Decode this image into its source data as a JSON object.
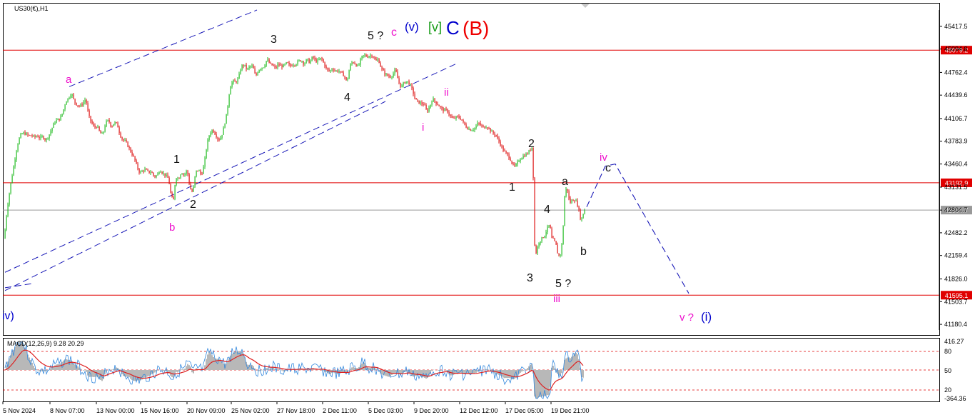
{
  "chart_data": {
    "type": "candlestick",
    "symbol": "US30(€),H1",
    "ylim": [
      41100,
      45650
    ],
    "price_ticks": [
      "45417.5",
      "45094.8",
      "44762.4",
      "44439.6",
      "44106.7",
      "43783.9",
      "43460.4",
      "43131.5",
      "42804.7",
      "42482.2",
      "42159.4",
      "41826.0",
      "41503.7",
      "41180.4"
    ],
    "time_ticks": [
      "5 Nov 2024",
      "8 Nov 07:00",
      "13 Nov 00:00",
      "15 Nov 16:00",
      "20 Nov 09:00",
      "25 Nov 02:00",
      "27 Nov 18:00",
      "2 Dec 11:00",
      "5 Dec 03:00",
      "9 Dec 20:00",
      "12 Dec 12:00",
      "17 Dec 05:00",
      "19 Dec 21:00"
    ],
    "levels": [
      {
        "price": 45079.2,
        "label": "45079.2",
        "color": "#e00000"
      },
      {
        "price": 43192.9,
        "label": "43192.9",
        "color": "#e00000"
      },
      {
        "price": 42804.7,
        "label": "42804.7",
        "color": "#999999"
      },
      {
        "price": 41595.1,
        "label": "41595.1",
        "color": "#e00000"
      }
    ],
    "price_path": [
      [
        0,
        41880
      ],
      [
        4,
        42150
      ],
      [
        8,
        42650
      ],
      [
        12,
        42980
      ],
      [
        16,
        43250
      ],
      [
        20,
        43480
      ],
      [
        24,
        43720
      ],
      [
        28,
        43860
      ],
      [
        32,
        43900
      ],
      [
        36,
        43890
      ],
      [
        40,
        43860
      ],
      [
        44,
        43870
      ],
      [
        48,
        43840
      ],
      [
        52,
        43860
      ],
      [
        56,
        43830
      ],
      [
        60,
        43850
      ],
      [
        64,
        43800
      ],
      [
        68,
        43860
      ],
      [
        72,
        43950
      ],
      [
        76,
        44050
      ],
      [
        80,
        44090
      ],
      [
        84,
        44100
      ],
      [
        88,
        44200
      ],
      [
        92,
        44350
      ],
      [
        96,
        44400
      ],
      [
        100,
        44470
      ],
      [
        104,
        44350
      ],
      [
        108,
        44300
      ],
      [
        112,
        44280
      ],
      [
        116,
        44320
      ],
      [
        120,
        44390
      ],
      [
        124,
        44150
      ],
      [
        128,
        44050
      ],
      [
        132,
        43980
      ],
      [
        136,
        44000
      ],
      [
        140,
        43900
      ],
      [
        144,
        43880
      ],
      [
        148,
        44050
      ],
      [
        152,
        44080
      ],
      [
        156,
        43990
      ],
      [
        160,
        44050
      ],
      [
        164,
        44030
      ],
      [
        168,
        43880
      ],
      [
        172,
        43800
      ],
      [
        176,
        43780
      ],
      [
        180,
        43700
      ],
      [
        184,
        43620
      ],
      [
        188,
        43540
      ],
      [
        192,
        43420
      ],
      [
        196,
        43330
      ],
      [
        200,
        43370
      ],
      [
        204,
        43380
      ],
      [
        208,
        43340
      ],
      [
        212,
        43350
      ],
      [
        216,
        43280
      ],
      [
        220,
        43300
      ],
      [
        224,
        43380
      ],
      [
        228,
        43330
      ],
      [
        232,
        43300
      ],
      [
        236,
        43250
      ],
      [
        240,
        42980
      ],
      [
        243,
        42950
      ],
      [
        246,
        43280
      ],
      [
        250,
        43250
      ],
      [
        254,
        43350
      ],
      [
        258,
        43300
      ],
      [
        262,
        43380
      ],
      [
        266,
        43120
      ],
      [
        270,
        43050
      ],
      [
        274,
        43350
      ],
      [
        278,
        43380
      ],
      [
        282,
        43300
      ],
      [
        286,
        43450
      ],
      [
        290,
        43750
      ],
      [
        294,
        43900
      ],
      [
        298,
        43950
      ],
      [
        302,
        43880
      ],
      [
        306,
        43800
      ],
      [
        310,
        43850
      ],
      [
        314,
        44000
      ],
      [
        318,
        44200
      ],
      [
        322,
        44550
      ],
      [
        326,
        44640
      ],
      [
        330,
        44620
      ],
      [
        334,
        44680
      ],
      [
        338,
        44850
      ],
      [
        342,
        44870
      ],
      [
        346,
        44800
      ],
      [
        350,
        44850
      ],
      [
        354,
        44850
      ],
      [
        358,
        44700
      ],
      [
        362,
        44800
      ],
      [
        366,
        44830
      ],
      [
        370,
        44850
      ],
      [
        374,
        44950
      ],
      [
        378,
        44880
      ],
      [
        382,
        44860
      ],
      [
        386,
        44820
      ],
      [
        390,
        44880
      ],
      [
        394,
        44850
      ],
      [
        398,
        44860
      ],
      [
        402,
        44900
      ],
      [
        406,
        44850
      ],
      [
        410,
        44880
      ],
      [
        414,
        44880
      ],
      [
        418,
        44920
      ],
      [
        422,
        44940
      ],
      [
        426,
        44880
      ],
      [
        430,
        44950
      ],
      [
        434,
        44900
      ],
      [
        438,
        44990
      ],
      [
        442,
        44920
      ],
      [
        446,
        44930
      ],
      [
        450,
        44970
      ],
      [
        454,
        44880
      ],
      [
        458,
        44800
      ],
      [
        462,
        44780
      ],
      [
        466,
        44820
      ],
      [
        470,
        44780
      ],
      [
        474,
        44790
      ],
      [
        478,
        44750
      ],
      [
        482,
        44720
      ],
      [
        486,
        44620
      ],
      [
        490,
        44850
      ],
      [
        494,
        44920
      ],
      [
        498,
        44880
      ],
      [
        502,
        44840
      ],
      [
        506,
        44970
      ],
      [
        510,
        45010
      ],
      [
        514,
        44990
      ],
      [
        518,
        45000
      ],
      [
        522,
        45010
      ],
      [
        526,
        44920
      ],
      [
        530,
        44950
      ],
      [
        534,
        44820
      ],
      [
        538,
        44760
      ],
      [
        542,
        44720
      ],
      [
        546,
        44700
      ],
      [
        550,
        44730
      ],
      [
        554,
        44800
      ],
      [
        558,
        44640
      ],
      [
        562,
        44550
      ],
      [
        566,
        44620
      ],
      [
        570,
        44640
      ],
      [
        574,
        44600
      ],
      [
        578,
        44500
      ],
      [
        582,
        44370
      ],
      [
        586,
        44340
      ],
      [
        590,
        44320
      ],
      [
        594,
        44310
      ],
      [
        598,
        44200
      ],
      [
        602,
        44280
      ],
      [
        606,
        44390
      ],
      [
        610,
        44340
      ],
      [
        614,
        44300
      ],
      [
        618,
        44250
      ],
      [
        622,
        44220
      ],
      [
        626,
        44230
      ],
      [
        630,
        44150
      ],
      [
        634,
        44100
      ],
      [
        638,
        44120
      ],
      [
        642,
        44130
      ],
      [
        646,
        44100
      ],
      [
        650,
        44030
      ],
      [
        654,
        43980
      ],
      [
        658,
        43950
      ],
      [
        662,
        43950
      ],
      [
        666,
        43980
      ],
      [
        670,
        44050
      ],
      [
        674,
        44000
      ],
      [
        678,
        43980
      ],
      [
        682,
        44000
      ],
      [
        686,
        43950
      ],
      [
        690,
        43900
      ],
      [
        694,
        43880
      ],
      [
        698,
        43800
      ],
      [
        702,
        43720
      ],
      [
        706,
        43640
      ],
      [
        710,
        43600
      ],
      [
        714,
        43550
      ],
      [
        718,
        43450
      ],
      [
        722,
        43420
      ],
      [
        726,
        43500
      ],
      [
        730,
        43550
      ],
      [
        734,
        43580
      ],
      [
        738,
        43600
      ],
      [
        742,
        43650
      ],
      [
        745,
        43700
      ],
      [
        747,
        43280
      ],
      [
        749,
        42300
      ],
      [
        751,
        42200
      ],
      [
        755,
        42350
      ],
      [
        759,
        42400
      ],
      [
        763,
        42450
      ],
      [
        767,
        42550
      ],
      [
        770,
        42600
      ],
      [
        773,
        42400
      ],
      [
        776,
        42380
      ],
      [
        779,
        42300
      ],
      [
        782,
        42150
      ],
      [
        785,
        42180
      ],
      [
        788,
        42380
      ],
      [
        791,
        43000
      ],
      [
        794,
        43150
      ],
      [
        798,
        42900
      ],
      [
        802,
        42950
      ],
      [
        806,
        42950
      ],
      [
        810,
        42850
      ],
      [
        814,
        42640
      ],
      [
        818,
        42800
      ],
      [
        822,
        42850
      ]
    ],
    "projection": [
      [
        822,
        42850
      ],
      [
        848,
        43430
      ],
      [
        862,
        43460
      ],
      [
        965,
        41620
      ]
    ],
    "trend_lines": [
      {
        "from": [
          7,
          41920
        ],
        "to": [
          638,
          44880
        ]
      },
      {
        "from": [
          97,
          44560
        ],
        "to": [
          360,
          45650
        ]
      },
      {
        "from": [
          7,
          41660
        ],
        "to": [
          540,
          44350
        ]
      },
      {
        "from": [
          7,
          41700
        ],
        "to": [
          45,
          41760
        ]
      }
    ],
    "macd": {
      "label": "MACD(12,26,9) 9.28 20.29",
      "ticks": [
        "416.27",
        "80",
        "50",
        "20",
        "-364.36"
      ]
    }
  },
  "wave_labels": [
    {
      "text": "iv)",
      "color": "#0000cc",
      "x": 3,
      "y": 447,
      "size": 16
    },
    {
      "text": "a",
      "color": "#ee11cc",
      "x": 92,
      "y": 116,
      "size": 15
    },
    {
      "text": "b",
      "color": "#ee11cc",
      "x": 237,
      "y": 323,
      "size": 15
    },
    {
      "text": "1",
      "color": "#111111",
      "x": 243,
      "y": 228,
      "size": 16
    },
    {
      "text": "2",
      "color": "#111111",
      "x": 266,
      "y": 291,
      "size": 16
    },
    {
      "text": "3",
      "color": "#111111",
      "x": 379,
      "y": 60,
      "size": 16
    },
    {
      "text": "4",
      "color": "#111111",
      "x": 482,
      "y": 141,
      "size": 16
    },
    {
      "text": "5 ?",
      "color": "#111111",
      "x": 515,
      "y": 55,
      "size": 16
    },
    {
      "text": "c",
      "color": "#ee11cc",
      "x": 548,
      "y": 50,
      "size": 16
    },
    {
      "text": "(v)",
      "color": "#0000cc",
      "x": 567,
      "y": 43,
      "size": 17
    },
    {
      "text": "[v]",
      "color": "#119911",
      "x": 600,
      "y": 44,
      "size": 18
    },
    {
      "text": "C",
      "color": "#0000cc",
      "x": 625,
      "y": 48,
      "size": 26
    },
    {
      "text": "(B)",
      "color": "#ee0000",
      "x": 648,
      "y": 49,
      "size": 28
    },
    {
      "text": "ii",
      "color": "#ee11cc",
      "x": 622,
      "y": 134,
      "size": 15
    },
    {
      "text": "i",
      "color": "#ee11cc",
      "x": 591,
      "y": 183,
      "size": 15
    },
    {
      "text": "2",
      "color": "#111111",
      "x": 740,
      "y": 206,
      "size": 16
    },
    {
      "text": "1",
      "color": "#111111",
      "x": 713,
      "y": 267,
      "size": 16
    },
    {
      "text": "3",
      "color": "#111111",
      "x": 738,
      "y": 394,
      "size": 16
    },
    {
      "text": "4",
      "color": "#111111",
      "x": 762,
      "y": 298,
      "size": 16
    },
    {
      "text": "5 ?",
      "color": "#111111",
      "x": 778,
      "y": 402,
      "size": 16
    },
    {
      "text": "iii",
      "color": "#ee11cc",
      "x": 775,
      "y": 423,
      "size": 15
    },
    {
      "text": "a",
      "color": "#111111",
      "x": 787,
      "y": 259,
      "size": 16
    },
    {
      "text": "b",
      "color": "#111111",
      "x": 813,
      "y": 357,
      "size": 16
    },
    {
      "text": "iv",
      "color": "#ee11cc",
      "x": 840,
      "y": 225,
      "size": 15
    },
    {
      "text": "c",
      "color": "#111111",
      "x": 848,
      "y": 240,
      "size": 16
    },
    {
      "text": "v ?",
      "color": "#ee11cc",
      "x": 952,
      "y": 449,
      "size": 15
    },
    {
      "text": "(i)",
      "color": "#0000cc",
      "x": 982,
      "y": 449,
      "size": 17
    }
  ],
  "colors": {
    "bull": "#22bb22",
    "bear": "#dd1111",
    "trend": "#1a1ab8",
    "macd_line": "#3388dd",
    "signal": "#dd2222",
    "hist": "#b8b8b8"
  }
}
